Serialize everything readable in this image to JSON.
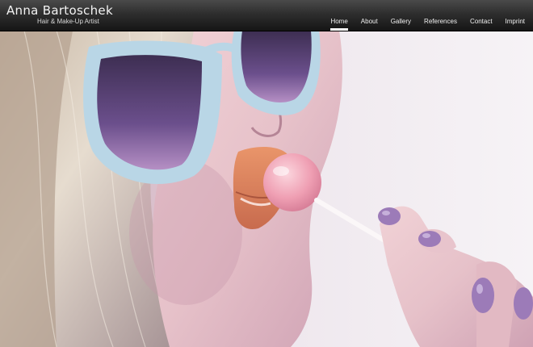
{
  "brand": {
    "name": "Anna Bartoschek",
    "tagline": "Hair & Make-Up Artist"
  },
  "nav": {
    "items": [
      {
        "label": "Home",
        "active": true
      },
      {
        "label": "About",
        "active": false
      },
      {
        "label": "Gallery",
        "active": false
      },
      {
        "label": "References",
        "active": false
      },
      {
        "label": "Contact",
        "active": false
      },
      {
        "label": "Imprint",
        "active": false
      }
    ]
  },
  "colors": {
    "topbar": "#2e2e2e",
    "nav_text": "#efefef",
    "active_underline": "#ffffff",
    "background_right": "#efeaef",
    "sunglasses_frame": "#b9d6e6",
    "lens": "#6a4a86",
    "lips": "#e0875e",
    "lollipop": "#f0a6b6",
    "nails": "#9c7bb8"
  }
}
